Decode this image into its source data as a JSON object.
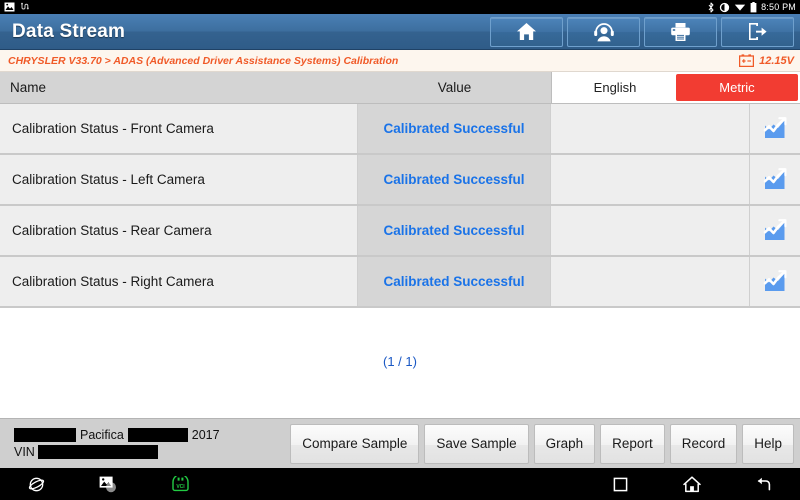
{
  "statusbar": {
    "icons_left": [
      "gallery-icon",
      "usb-debug-icon"
    ],
    "icons_right": [
      "bluetooth-icon",
      "brightness-icon",
      "wifi-icon",
      "battery-icon"
    ],
    "clock": "8:50 PM"
  },
  "header": {
    "title": "Data Stream",
    "buttons": [
      {
        "name": "home-button",
        "icon": "home-icon"
      },
      {
        "name": "support-button",
        "icon": "headset-person-icon"
      },
      {
        "name": "print-button",
        "icon": "printer-icon"
      },
      {
        "name": "exit-button",
        "icon": "exit-door-icon"
      }
    ]
  },
  "breadcrumb": {
    "path": "CHRYSLER V33.70 > ADAS (Advanced Driver Assistance Systems) Calibration",
    "battery_icon": "battery-voltage-icon",
    "voltage": "12.15V"
  },
  "table": {
    "columns": {
      "name": "Name",
      "value": "Value"
    },
    "unit_toggle": {
      "options": [
        "English",
        "Metric"
      ],
      "selected": "Metric",
      "active_color": "#f23c32"
    },
    "graph_icon": "line-chart-icon",
    "rows": [
      {
        "name": "Calibration Status - Front Camera",
        "value": "Calibrated Successful",
        "unit": ""
      },
      {
        "name": "Calibration Status - Left Camera",
        "value": "Calibrated Successful",
        "unit": ""
      },
      {
        "name": "Calibration Status - Rear Camera",
        "value": "Calibrated Successful",
        "unit": ""
      },
      {
        "name": "Calibration Status - Right Camera",
        "value": "Calibrated Successful",
        "unit": ""
      }
    ]
  },
  "pagination": {
    "label": "(1 / 1)"
  },
  "vehicle": {
    "model": "Pacifica",
    "year": "2017",
    "vin_label": "VIN",
    "redacted_make_width": 62,
    "redacted_trim_width": 60,
    "redacted_vin_width": 120
  },
  "actions": [
    {
      "name": "compare-sample-button",
      "label": "Compare Sample"
    },
    {
      "name": "save-sample-button",
      "label": "Save Sample"
    },
    {
      "name": "graph-button",
      "label": "Graph"
    },
    {
      "name": "report-button",
      "label": "Report"
    },
    {
      "name": "record-button",
      "label": "Record"
    },
    {
      "name": "help-button",
      "label": "Help"
    }
  ],
  "navbar": {
    "left": [
      "browser-icon",
      "screenshot-icon",
      "vci-connector-icon"
    ],
    "right": [
      "recents-square-icon",
      "home-icon",
      "back-arrow-icon"
    ],
    "vci_label": "VCI",
    "vci_color": "#22cc44"
  },
  "colors": {
    "title_blue": "#3d6f9f",
    "breadcrumb_orange": "#f05a28",
    "value_blue": "#1a73e8",
    "metric_red": "#f23c32",
    "page_blue": "#1a58c4"
  }
}
